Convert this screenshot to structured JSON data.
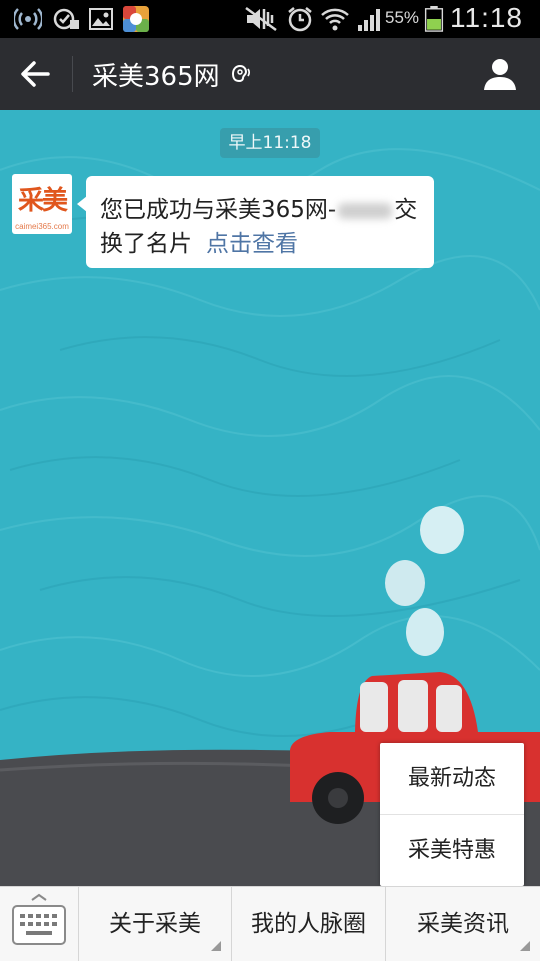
{
  "status_bar": {
    "battery_percent": "55%",
    "time": "11:18",
    "icons": [
      "wifi-hotspot-icon",
      "sync-icon",
      "gallery-icon",
      "app-icon",
      "mute-icon",
      "alarm-icon",
      "wifi-icon",
      "signal-icon",
      "battery-icon"
    ]
  },
  "header": {
    "title": "采美365网",
    "back_icon": "back-arrow-icon",
    "earpiece_icon": "earpiece-icon",
    "profile_icon": "person-icon",
    "color": "#2c2d31"
  },
  "chat": {
    "timestamp": "早上11:18",
    "avatar": {
      "logo_text": "采美",
      "caption": "caimei365.com"
    },
    "message": {
      "line1_before": "您已成功与采美365网-",
      "line1_after": "交",
      "line2": "换了名片",
      "link_text": "点击查看"
    },
    "background_color": "#35b3c5"
  },
  "popup_menu": {
    "items": [
      "最新动态",
      "采美特惠"
    ]
  },
  "bottom_bar": {
    "keyboard_icon": "keyboard-icon",
    "tabs": [
      "关于采美",
      "我的人脉圈",
      "采美资讯"
    ]
  }
}
